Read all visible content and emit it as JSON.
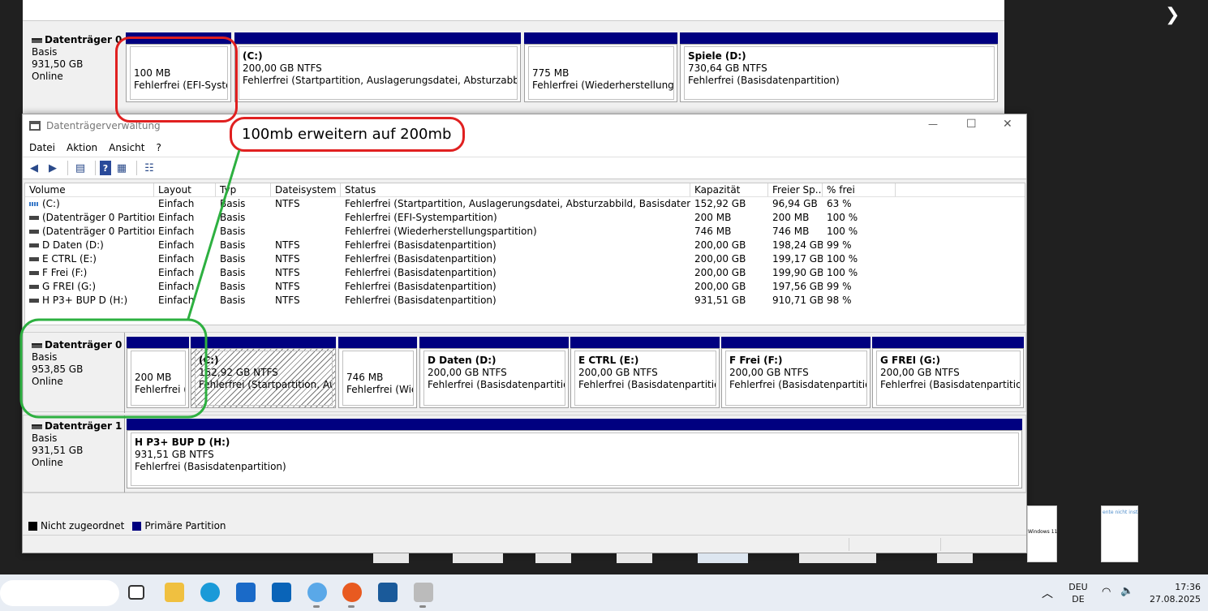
{
  "annotation": {
    "text": "100mb erweitern auf 200mb"
  },
  "background_window": {
    "disk": {
      "name": "Datenträger 0",
      "type": "Basis",
      "size": "931,50 GB",
      "status": "Online"
    },
    "partitions": [
      {
        "name": "",
        "size": "100 MB",
        "status": "Fehlerfrei (EFI-Systemp"
      },
      {
        "name": "(C:)",
        "size": "200,00 GB NTFS",
        "status": "Fehlerfrei (Startpartition, Auslagerungsdatei, Absturzabbild, Basis"
      },
      {
        "name": "",
        "size": "775 MB",
        "status": "Fehlerfrei (Wiederherstellungspart"
      },
      {
        "name": "Spiele  (D:)",
        "size": "730,64 GB NTFS",
        "status": "Fehlerfrei (Basisdatenpartition)"
      }
    ]
  },
  "window": {
    "title": "Datenträgerverwaltung",
    "menu": [
      "Datei",
      "Aktion",
      "Ansicht",
      "?"
    ],
    "controls": {
      "minimize": "—",
      "maximize": "☐",
      "close": "✕"
    }
  },
  "table": {
    "columns": [
      "Volume",
      "Layout",
      "Typ",
      "Dateisystem",
      "Status",
      "Kapazität",
      "Freier Sp...",
      "% frei"
    ],
    "rows": [
      [
        "(C:)",
        "Einfach",
        "Basis",
        "NTFS",
        "Fehlerfrei (Startpartition, Auslagerungsdatei, Absturzabbild, Basisdatenpartition)",
        "152,92 GB",
        "96,94 GB",
        "63 %"
      ],
      [
        "(Datenträger 0 Partition 1)",
        "Einfach",
        "Basis",
        "",
        "Fehlerfrei (EFI-Systempartition)",
        "200 MB",
        "200 MB",
        "100 %"
      ],
      [
        "(Datenträger 0 Partition 4)",
        "Einfach",
        "Basis",
        "",
        "Fehlerfrei (Wiederherstellungspartition)",
        "746 MB",
        "746 MB",
        "100 %"
      ],
      [
        "D Daten (D:)",
        "Einfach",
        "Basis",
        "NTFS",
        "Fehlerfrei (Basisdatenpartition)",
        "200,00 GB",
        "198,24 GB",
        "99 %"
      ],
      [
        "E CTRL (E:)",
        "Einfach",
        "Basis",
        "NTFS",
        "Fehlerfrei (Basisdatenpartition)",
        "200,00 GB",
        "199,17 GB",
        "100 %"
      ],
      [
        "F Frei (F:)",
        "Einfach",
        "Basis",
        "NTFS",
        "Fehlerfrei (Basisdatenpartition)",
        "200,00 GB",
        "199,90 GB",
        "100 %"
      ],
      [
        "G FREI (G:)",
        "Einfach",
        "Basis",
        "NTFS",
        "Fehlerfrei (Basisdatenpartition)",
        "200,00 GB",
        "197,56 GB",
        "99 %"
      ],
      [
        "H P3+ BUP D (H:)",
        "Einfach",
        "Basis",
        "NTFS",
        "Fehlerfrei (Basisdatenpartition)",
        "931,51 GB",
        "910,71 GB",
        "98 %"
      ]
    ]
  },
  "disk0": {
    "name": "Datenträger 0",
    "type": "Basis",
    "size": "953,85 GB",
    "status": "Online",
    "partitions": [
      {
        "name": "",
        "size": "200 MB",
        "status": "Fehlerfrei (EI"
      },
      {
        "name": "(C:)",
        "size": "152,92 GB NTFS",
        "status": "Fehlerfrei (Startpartition, Auslag"
      },
      {
        "name": "",
        "size": "746 MB",
        "status": "Fehlerfrei (Wied"
      },
      {
        "name": "D Daten  (D:)",
        "size": "200,00 GB NTFS",
        "status": "Fehlerfrei (Basisdatenpartition)"
      },
      {
        "name": "E CTRL  (E:)",
        "size": "200,00 GB NTFS",
        "status": "Fehlerfrei (Basisdatenpartition)"
      },
      {
        "name": "F Frei  (F:)",
        "size": "200,00 GB NTFS",
        "status": "Fehlerfrei (Basisdatenpartition)"
      },
      {
        "name": "G FREI  (G:)",
        "size": "200,00 GB NTFS",
        "status": "Fehlerfrei (Basisdatenpartition)"
      }
    ]
  },
  "disk1": {
    "name": "Datenträger 1",
    "type": "Basis",
    "size": "931,51 GB",
    "status": "Online",
    "partition": {
      "name": "H P3+ BUP D  (H:)",
      "size": "931,51 GB NTFS",
      "status": "Fehlerfrei (Basisdatenpartition)"
    }
  },
  "legend": {
    "unallocated": "Nicht zugeordnet",
    "primary": "Primäre Partition",
    "unallocated_color": "#000000",
    "primary_color": "#000080"
  },
  "taskbar": {
    "lang_top": "DEU",
    "lang_bottom": "DE",
    "time": "17:36",
    "date": "27.08.2025",
    "apps": [
      "taskview-icon",
      "file-explorer-icon",
      "edge-icon",
      "store-icon",
      "outlook-icon",
      "app-icon",
      "firefox-icon",
      "solitaire-icon",
      "disk-management-icon"
    ]
  },
  "side_arrow": "❯",
  "thumb_text": {
    "right": "Windows 11 ist f",
    "far_right": "ente nicht installi"
  }
}
